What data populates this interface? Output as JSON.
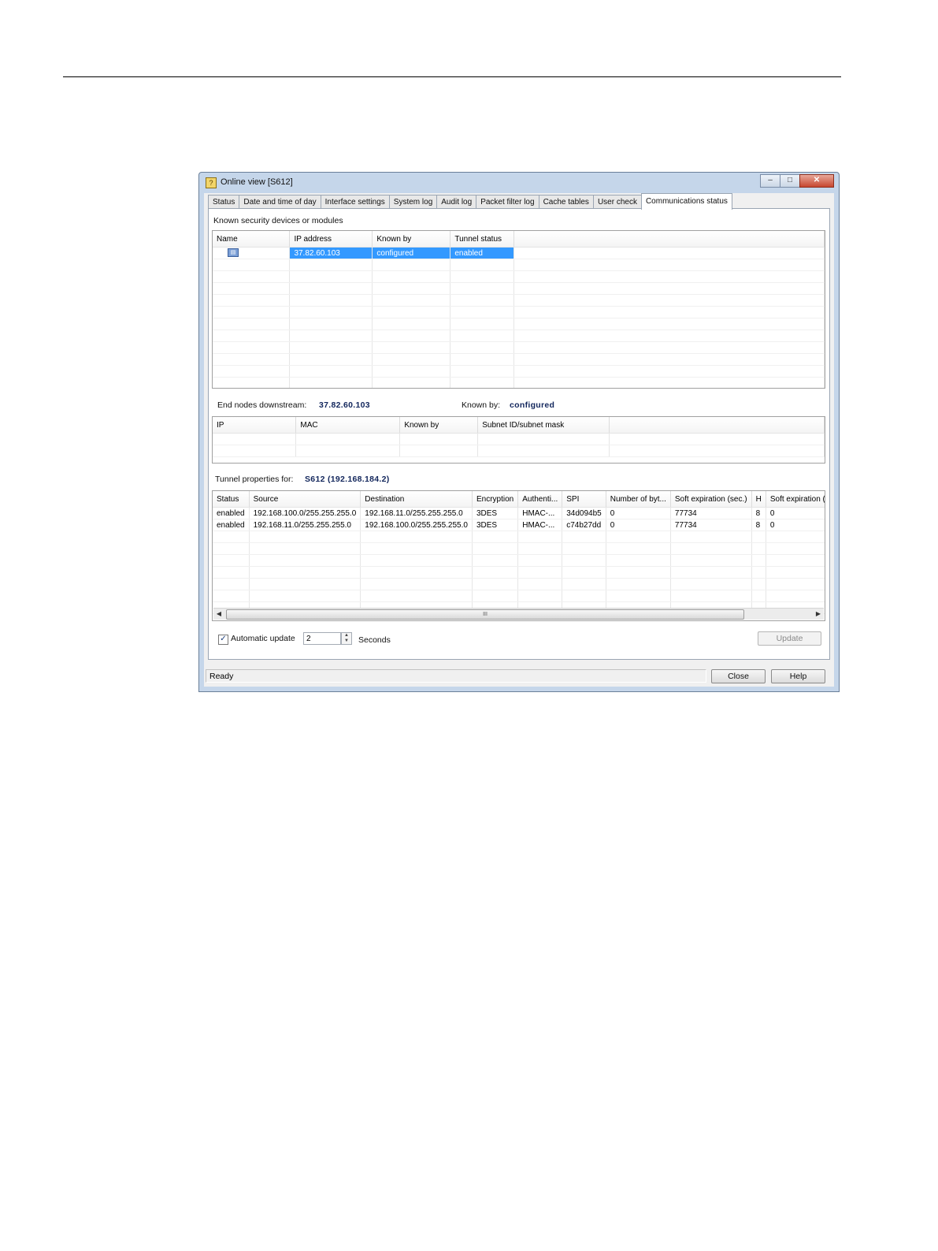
{
  "window": {
    "title": "Online view [S612]",
    "minimize": "–",
    "maximize": "□",
    "close": "✕"
  },
  "tabs": [
    {
      "label": "Status"
    },
    {
      "label": "Date and time of day"
    },
    {
      "label": "Interface settings"
    },
    {
      "label": "System log"
    },
    {
      "label": "Audit log"
    },
    {
      "label": "Packet filter log"
    },
    {
      "label": "Cache tables"
    },
    {
      "label": "User check"
    },
    {
      "label": "Communications status",
      "active": true
    }
  ],
  "known_devices": {
    "heading": "Known security devices or modules",
    "columns": [
      "Name",
      "IP address",
      "Known by",
      "Tunnel status"
    ],
    "rows": [
      {
        "name_icon": "device-icon",
        "ip": "37.82.60.103",
        "known_by": "configured",
        "tunnel_status": "enabled",
        "selected": true
      }
    ]
  },
  "end_nodes": {
    "label": "End nodes downstream:",
    "value": "37.82.60.103",
    "known_by_label": "Known by:",
    "known_by_value": "configured",
    "columns": [
      "IP",
      "MAC",
      "Known by",
      "Subnet ID/subnet mask"
    ]
  },
  "tunnel": {
    "label": "Tunnel properties for:",
    "value": "S612 (192.168.184.2)",
    "columns": [
      "Status",
      "Source",
      "Destination",
      "Encryption",
      "Authenti...",
      "SPI",
      "Number of byt...",
      "Soft expiration (sec.)",
      "H",
      "Soft expiration ("
    ],
    "rows": [
      [
        "enabled",
        "192.168.100.0/255.255.255.0",
        "192.168.11.0/255.255.255.0",
        "3DES",
        "HMAC-...",
        "34d094b5",
        "0",
        "77734",
        "8",
        "0"
      ],
      [
        "enabled",
        "192.168.11.0/255.255.255.0",
        "192.168.100.0/255.255.255.0",
        "3DES",
        "HMAC-...",
        "c74b27dd",
        "0",
        "77734",
        "8",
        "0"
      ]
    ],
    "scroll_grip": "III"
  },
  "auto_update": {
    "label": "Automatic update",
    "checked": true,
    "check_mark": "✓",
    "interval": "2",
    "unit": "Seconds"
  },
  "buttons": {
    "update": "Update",
    "close": "Close",
    "help": "Help"
  },
  "status": "Ready"
}
